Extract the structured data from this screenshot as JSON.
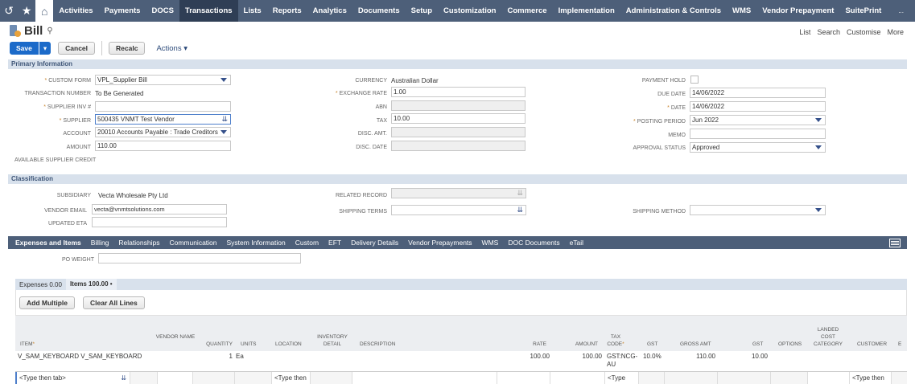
{
  "nav": {
    "items": [
      "Activities",
      "Payments",
      "DOCS",
      "Transactions",
      "Lists",
      "Reports",
      "Analytics",
      "Documents",
      "Setup",
      "Customization",
      "Commerce",
      "Implementation",
      "Administration & Controls",
      "WMS",
      "Vendor Prepayment",
      "SuitePrint"
    ],
    "active_index": 3,
    "more": "..."
  },
  "header": {
    "title": "Bill",
    "links": [
      "List",
      "Search",
      "Customise",
      "More"
    ]
  },
  "toolbar": {
    "save": "Save",
    "cancel": "Cancel",
    "recalc": "Recalc",
    "actions": "Actions"
  },
  "primary": {
    "heading": "Primary Information",
    "custom_form": {
      "label": "Custom Form",
      "value": "VPL_Supplier Bill"
    },
    "transaction_number": {
      "label": "Transaction Number",
      "value": "To Be Generated"
    },
    "supplier_inv": {
      "label": "Supplier Inv #",
      "value": ""
    },
    "supplier": {
      "label": "Supplier",
      "value": "500435 VNMT Test Vendor"
    },
    "account": {
      "label": "Account",
      "value": "20010 Accounts Payable : Trade Creditors"
    },
    "amount": {
      "label": "Amount",
      "value": "110.00"
    },
    "available_credit": {
      "label": "Available Supplier Credit"
    },
    "currency": {
      "label": "Currency",
      "value": "Australian Dollar"
    },
    "exchange_rate": {
      "label": "Exchange Rate",
      "value": "1.00"
    },
    "abn": {
      "label": "ABN",
      "value": ""
    },
    "tax": {
      "label": "Tax",
      "value": "10.00"
    },
    "disc_amt": {
      "label": "Disc. Amt.",
      "value": ""
    },
    "disc_date": {
      "label": "Disc. Date",
      "value": ""
    },
    "payment_hold": {
      "label": "Payment Hold"
    },
    "due_date": {
      "label": "Due Date",
      "value": "14/06/2022"
    },
    "date": {
      "label": "Date",
      "value": "14/06/2022"
    },
    "posting_period": {
      "label": "Posting Period",
      "value": "Jun 2022"
    },
    "memo": {
      "label": "Memo",
      "value": ""
    },
    "approval_status": {
      "label": "Approval Status",
      "value": "Approved"
    }
  },
  "classification": {
    "heading": "Classification",
    "subsidiary": {
      "label": "Subsidiary",
      "value": "Vecta Wholesale Pty Ltd"
    },
    "vendor_email": {
      "label": "Vendor Email",
      "value": "vecta@vnmtsolutions.com"
    },
    "updated_eta": {
      "label": "Updated ETA",
      "value": ""
    },
    "related_record": {
      "label": "Related Record",
      "value": ""
    },
    "shipping_terms": {
      "label": "Shipping Terms",
      "value": ""
    },
    "shipping_method": {
      "label": "Shipping Method",
      "value": ""
    }
  },
  "tabs": [
    "Expenses and Items",
    "Billing",
    "Relationships",
    "Communication",
    "System Information",
    "Custom",
    "EFT",
    "Delivery Details",
    "Vendor Prepayments",
    "WMS",
    "DOC Documents",
    "eTail"
  ],
  "po_weight": {
    "label": "PO Weight",
    "value": ""
  },
  "subtabs": {
    "expenses": "Expenses 0.00",
    "items": "Items 100.00 •"
  },
  "item_buttons": {
    "add_multiple": "Add Multiple",
    "clear_all": "Clear All Lines"
  },
  "grid": {
    "headers": {
      "item": "Item",
      "vendor_name": "Vendor Name",
      "quantity": "Quantity",
      "units": "Units",
      "location": "Location",
      "inventory_detail": "Inventory Detail",
      "description": "Description",
      "rate": "Rate",
      "amount": "Amount",
      "tax_code": "Tax Code",
      "gst": "GST",
      "gross_amt": "Gross Amt",
      "gst2": "GST",
      "options": "Options",
      "landed_cost": "Landed Cost Category",
      "customer": "Customer",
      "extra": "E"
    },
    "row": {
      "item": "V_SAM_KEYBOARD V_SAM_KEYBOARD",
      "quantity": "1",
      "units": "Ea",
      "rate": "100.00",
      "amount": "100.00",
      "tax_code": "GST:NCG-AU",
      "gst_rate": "10.0%",
      "gross_amt": "110.00",
      "gst_amt": "10.00"
    },
    "edit": {
      "item": "<Type then tab>",
      "location": "<Type then",
      "tax_code": "<Type",
      "customer": "<Type then"
    }
  }
}
